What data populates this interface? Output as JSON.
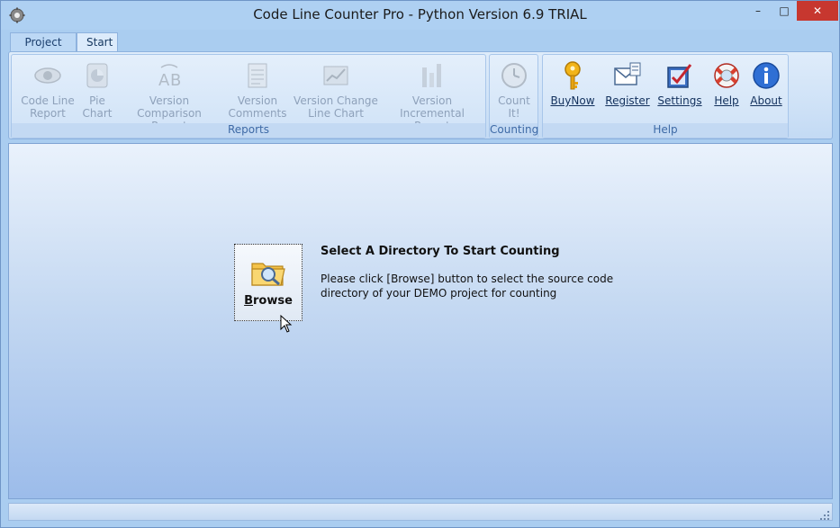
{
  "window": {
    "title": "Code Line Counter Pro - Python Version 6.9 TRIAL",
    "controls": {
      "minimize": "–",
      "maximize": "□",
      "close": "✕"
    }
  },
  "tabs": [
    {
      "label": "Project",
      "active": false
    },
    {
      "label": "Start",
      "active": true
    }
  ],
  "ribbon": {
    "groups": [
      {
        "label": "Reports",
        "buttons": [
          {
            "line1": "Code Line",
            "line2": "Report",
            "icon": "eye-icon",
            "enabled": false
          },
          {
            "line1": "Pie",
            "line2": "Chart",
            "icon": "pie-chart-icon",
            "enabled": false
          },
          {
            "line1": "Version",
            "line2": "Comparison Report",
            "icon": "ab-compare-icon",
            "enabled": false
          },
          {
            "line1": "Version",
            "line2": "Comments",
            "icon": "notepad-icon",
            "enabled": false
          },
          {
            "line1": "Version Change",
            "line2": "Line Chart",
            "icon": "line-chart-icon",
            "enabled": false
          },
          {
            "line1": "Version",
            "line2": "Incremental Report",
            "icon": "bar-chart-icon",
            "enabled": false
          }
        ]
      },
      {
        "label": "Counting",
        "buttons": [
          {
            "line1": "Count",
            "line2": "It!",
            "icon": "clock-icon",
            "enabled": false
          }
        ]
      },
      {
        "label": "Help",
        "buttons": [
          {
            "line1": "BuyNow",
            "line2": "",
            "icon": "key-icon",
            "enabled": true
          },
          {
            "line1": "Register",
            "line2": "",
            "icon": "register-envelope-icon",
            "enabled": true
          },
          {
            "line1": "Settings",
            "line2": "",
            "icon": "settings-check-icon",
            "enabled": true
          },
          {
            "line1": "Help",
            "line2": "",
            "icon": "lifebuoy-icon",
            "enabled": true
          },
          {
            "line1": "About",
            "line2": "",
            "icon": "info-icon",
            "enabled": true
          }
        ]
      }
    ]
  },
  "main": {
    "browse_label": "Browse",
    "browse_accel": "B",
    "browse_rest": "rowse",
    "instruction_title": "Select A Directory To Start Counting",
    "instruction_line1": "Please click [Browse] button to select the source code",
    "instruction_line2": "directory of your DEMO project for counting"
  },
  "colors": {
    "accent": "#3e6aa6",
    "close_button": "#c7372f",
    "disabled_text": "#8ea1ba"
  }
}
